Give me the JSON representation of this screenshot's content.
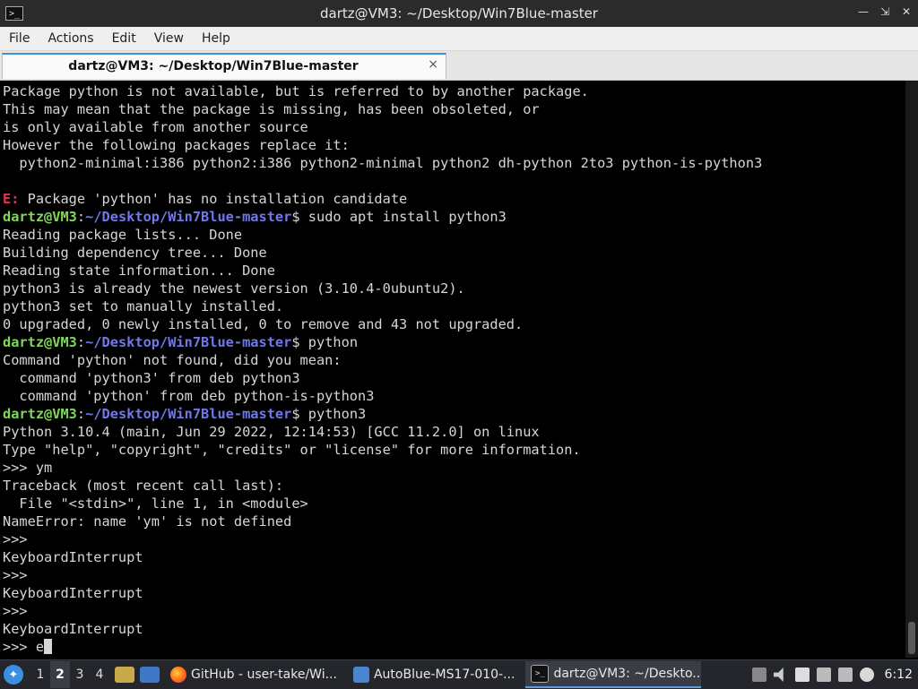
{
  "window": {
    "title": "dartz@VM3: ~/Desktop/Win7Blue-master",
    "app_icon": "terminal-icon",
    "controls": [
      "minimize-icon",
      "maximize-icon",
      "close-icon"
    ]
  },
  "menu": [
    "File",
    "Actions",
    "Edit",
    "View",
    "Help"
  ],
  "tab": {
    "label": "dartz@VM3: ~/Desktop/Win7Blue-master",
    "close_glyph": "×"
  },
  "colors": {
    "prompt_user": "#7fd858",
    "prompt_path": "#6f79e8",
    "error": "#e2354a",
    "text": "#d6d6d6",
    "background": "#000000"
  },
  "terminal": {
    "lines": [
      [
        {
          "t": "Package python is not available, but is referred to by another package.",
          "c": "out"
        }
      ],
      [
        {
          "t": "This may mean that the package is missing, has been obsoleted, or",
          "c": "out"
        }
      ],
      [
        {
          "t": "is only available from another source",
          "c": "out"
        }
      ],
      [
        {
          "t": "However the following packages replace it:",
          "c": "out"
        }
      ],
      [
        {
          "t": "  python2-minimal:i386 python2:i386 python2-minimal python2 dh-python 2to3 python-is-python3",
          "c": "out"
        }
      ],
      [
        {
          "t": "",
          "c": "out"
        }
      ],
      [
        {
          "t": "E:",
          "c": "err"
        },
        {
          "t": " Package 'python' has no installation candidate",
          "c": "out"
        }
      ],
      [
        {
          "t": "dartz@VM3",
          "c": "user"
        },
        {
          "t": ":",
          "c": "colon"
        },
        {
          "t": "~/Desktop/Win7Blue-master",
          "c": "path"
        },
        {
          "t": "$ sudo apt install python3",
          "c": "out"
        }
      ],
      [
        {
          "t": "Reading package lists... Done",
          "c": "out"
        }
      ],
      [
        {
          "t": "Building dependency tree... Done",
          "c": "out"
        }
      ],
      [
        {
          "t": "Reading state information... Done",
          "c": "out"
        }
      ],
      [
        {
          "t": "python3 is already the newest version (3.10.4-0ubuntu2).",
          "c": "out"
        }
      ],
      [
        {
          "t": "python3 set to manually installed.",
          "c": "out"
        }
      ],
      [
        {
          "t": "0 upgraded, 0 newly installed, 0 to remove and 43 not upgraded.",
          "c": "out"
        }
      ],
      [
        {
          "t": "dartz@VM3",
          "c": "user"
        },
        {
          "t": ":",
          "c": "colon"
        },
        {
          "t": "~/Desktop/Win7Blue-master",
          "c": "path"
        },
        {
          "t": "$ python",
          "c": "out"
        }
      ],
      [
        {
          "t": "Command 'python' not found, did you mean:",
          "c": "out"
        }
      ],
      [
        {
          "t": "  command 'python3' from deb python3",
          "c": "out"
        }
      ],
      [
        {
          "t": "  command 'python' from deb python-is-python3",
          "c": "out"
        }
      ],
      [
        {
          "t": "dartz@VM3",
          "c": "user"
        },
        {
          "t": ":",
          "c": "colon"
        },
        {
          "t": "~/Desktop/Win7Blue-master",
          "c": "path"
        },
        {
          "t": "$ python3",
          "c": "out"
        }
      ],
      [
        {
          "t": "Python 3.10.4 (main, Jun 29 2022, 12:14:53) [GCC 11.2.0] on linux",
          "c": "out"
        }
      ],
      [
        {
          "t": "Type \"help\", \"copyright\", \"credits\" or \"license\" for more information.",
          "c": "out"
        }
      ],
      [
        {
          "t": ">>> ym",
          "c": "out"
        }
      ],
      [
        {
          "t": "Traceback (most recent call last):",
          "c": "out"
        }
      ],
      [
        {
          "t": "  File \"<stdin>\", line 1, in <module>",
          "c": "out"
        }
      ],
      [
        {
          "t": "NameError: name 'ym' is not defined",
          "c": "out"
        }
      ],
      [
        {
          "t": ">>>",
          "c": "out"
        }
      ],
      [
        {
          "t": "KeyboardInterrupt",
          "c": "out"
        }
      ],
      [
        {
          "t": ">>>",
          "c": "out"
        }
      ],
      [
        {
          "t": "KeyboardInterrupt",
          "c": "out"
        }
      ],
      [
        {
          "t": ">>>",
          "c": "out"
        }
      ],
      [
        {
          "t": "KeyboardInterrupt",
          "c": "out"
        }
      ],
      [
        {
          "t": ">>> e",
          "c": "out"
        }
      ]
    ]
  },
  "taskbar": {
    "start_icon": "start-menu-icon",
    "workspaces": [
      "1",
      "2",
      "3",
      "4"
    ],
    "active_workspace": "2",
    "quick_launch": [
      "file-manager-icon",
      "show-desktop-icon"
    ],
    "tasks": [
      {
        "label": "GitHub - user-take/Wi...",
        "icon": "firefox-icon",
        "active": false
      },
      {
        "label": "AutoBlue-MS17-010-...",
        "icon": "folder-icon",
        "active": false
      },
      {
        "label": "dartz@VM3: ~/Deskto...",
        "icon": "terminal-icon",
        "active": true
      }
    ],
    "tray": [
      "upload-icon",
      "volume-icon",
      "clipboard-icon",
      "display-icon",
      "network-icon",
      "power-icon"
    ],
    "clock": "6:12"
  }
}
